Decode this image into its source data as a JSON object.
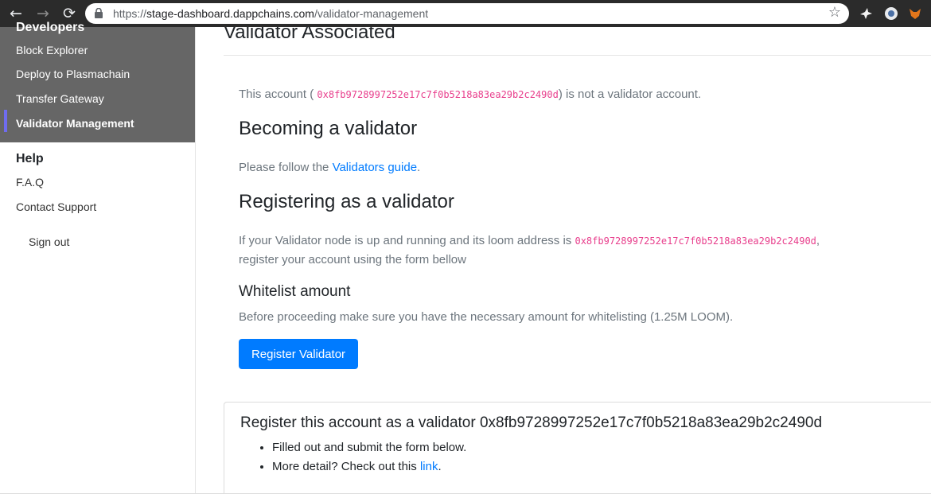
{
  "browser": {
    "url_prefix": "https://",
    "url_host": "stage-dashboard.dappchains.com",
    "url_path": "/validator-management"
  },
  "sidebar": {
    "developers_heading": "Developers",
    "developer_items": [
      {
        "label": "Block Explorer"
      },
      {
        "label": "Deploy to Plasmachain"
      },
      {
        "label": "Transfer Gateway"
      },
      {
        "label": "Validator Management",
        "active": true
      }
    ],
    "help_heading": "Help",
    "help_items": [
      {
        "label": "F.A.Q"
      },
      {
        "label": "Contact Support"
      }
    ],
    "signout_label": "Sign out"
  },
  "main": {
    "title": "Validator Associated",
    "account_notice": {
      "prefix": "This account (",
      "address": "0x8fb9728997252e17c7f0b5218a83ea29b2c2490d",
      "suffix": ") is not a validator account."
    },
    "becoming_heading": "Becoming a validator",
    "guide_text": {
      "prefix": "Please follow the ",
      "link": "Validators guide",
      "suffix": "."
    },
    "registering_heading": "Registering as a validator",
    "registering_text": {
      "line1_prefix": "If your Validator node is up and running and its loom address is ",
      "address": "0x8fb9728997252e17c7f0b5218a83ea29b2c2490d",
      "line1_suffix": ",",
      "line2": "register your account using the form bellow"
    },
    "whitelist_heading": "Whitelist amount",
    "whitelist_text": "Before proceeding make sure you have the necessary amount for whitelisting (1.25M LOOM).",
    "register_button": "Register Validator",
    "card": {
      "title": "Register this account as a validator 0x8fb9728997252e17c7f0b5218a83ea29b2c2490d",
      "bullet1": "Filled out and submit the form below.",
      "bullet2_prefix": "More detail? Check out this ",
      "bullet2_link": "link",
      "bullet2_suffix": "."
    }
  },
  "colors": {
    "primary": "#007bff",
    "address_pink": "#e83e8c",
    "sidebar_dark": "#666666",
    "active_indicator": "#6f6cf0"
  }
}
